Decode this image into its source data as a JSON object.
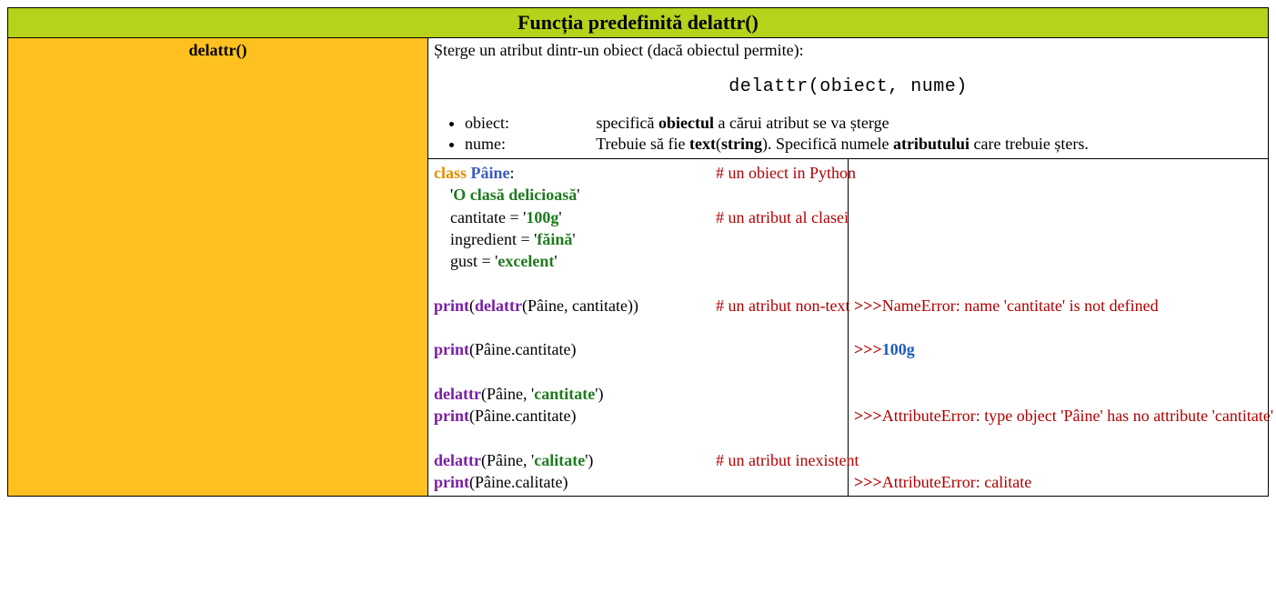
{
  "header": {
    "title": "Funcția predefinită delattr()"
  },
  "sidebar": {
    "label": "delattr()"
  },
  "desc": {
    "intro": "Șterge un atribut dintr-un obiect (dacă obiectul permite):",
    "syntax": "delattr(obiect, nume)",
    "params": {
      "obiect": {
        "name": "obiect:",
        "pre": "specifică ",
        "bold1": "obiectul",
        "post": " a cărui atribut se va șterge"
      },
      "nume": {
        "name": "nume:",
        "pre": "Trebuie să fie ",
        "bold1": "text",
        "mid1": "(",
        "bold2": "string",
        "mid2": "). Specifică numele ",
        "bold3": "atributului",
        "post": " care trebuie șters."
      }
    }
  },
  "code": {
    "l1": {
      "class_kw": "class ",
      "name": "Pâine",
      "colon": ":",
      "comment": "# un obiect in Python"
    },
    "l2": {
      "q1": "'",
      "str": "O clasă delicioasă",
      "q2": "'"
    },
    "l3": {
      "attr": "cantitate = '",
      "val": "100g",
      "q": "'",
      "comment": "# un atribut al clasei"
    },
    "l4": {
      "attr": "ingredient = '",
      "val": "făină",
      "q": "'"
    },
    "l5": {
      "attr": "gust = '",
      "val": "excelent",
      "q": "'"
    },
    "l7": {
      "print": "print",
      "p1": "(",
      "fn": "delattr",
      "p2": "(Pâine, cantitate))",
      "comment": "# un atribut non-text"
    },
    "l9": {
      "print": "print",
      "rest": "(Pâine.cantitate)"
    },
    "l11": {
      "fn": "delattr",
      "p1": "(Pâine, '",
      "str": "cantitate",
      "p2": "')"
    },
    "l12": {
      "print": "print",
      "rest": "(Pâine.cantitate)"
    },
    "l14": {
      "fn": "delattr",
      "p1": "(Pâine, '",
      "str": "calitate",
      "p2": "')",
      "comment": "# un atribut inexistent"
    },
    "l15": {
      "print": "print",
      "rest": "(Pâine.calitate)"
    }
  },
  "out": {
    "o7": {
      "prompt": ">>>",
      "text": "NameError: name 'cantitate' is not defined"
    },
    "o9": {
      "prompt": ">>>",
      "text": "100g"
    },
    "o12": {
      "prompt": ">>>",
      "text": "AttributeError: type object 'Pâine' has no attribute 'cantitate'"
    },
    "o15": {
      "prompt": ">>>",
      "text": "AttributeError: calitate"
    }
  },
  "blank": " "
}
